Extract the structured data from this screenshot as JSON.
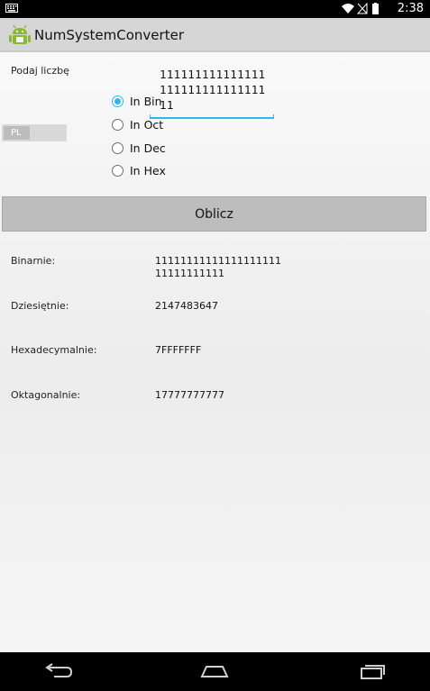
{
  "status_bar": {
    "time": "2:38"
  },
  "app": {
    "title": "NumSystemConverter"
  },
  "input": {
    "prompt_label": "Podaj liczbę",
    "value": "11111111111111111111111111111111"
  },
  "language_toggle": {
    "label": "PL"
  },
  "radio_options": [
    {
      "label": "In Bin",
      "checked": true
    },
    {
      "label": "In Oct",
      "checked": false
    },
    {
      "label": "In Dec",
      "checked": false
    },
    {
      "label": "In Hex",
      "checked": false
    }
  ],
  "calculate_button": {
    "label": "Oblicz"
  },
  "results": [
    {
      "label": "Binarnie:",
      "value": "1111111111111111111111111111111"
    },
    {
      "label": "Dziesiętnie:",
      "value": "2147483647"
    },
    {
      "label": "Hexadecymalnie:",
      "value": "7FFFFFFF"
    },
    {
      "label": "Oktagonalnie:",
      "value": "17777777777"
    }
  ],
  "colors": {
    "accent": "#33b5e5",
    "action_bar": "#d6d6d6",
    "button": "#bdbdbd"
  }
}
